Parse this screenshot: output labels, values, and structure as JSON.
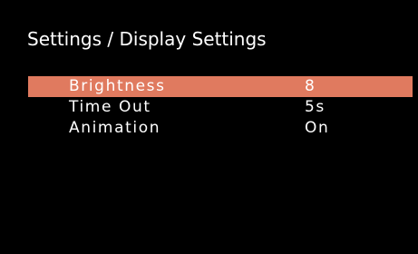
{
  "header": {
    "title": "Settings / Display Settings"
  },
  "menu": {
    "items": [
      {
        "label": "Brightness",
        "value": "8",
        "selected": true
      },
      {
        "label": "Time Out",
        "value": "5s",
        "selected": false
      },
      {
        "label": "Animation",
        "value": "On",
        "selected": false
      }
    ]
  },
  "colors": {
    "background": "#000000",
    "text": "#ffffff",
    "selection_highlight": "#e07a5f"
  }
}
